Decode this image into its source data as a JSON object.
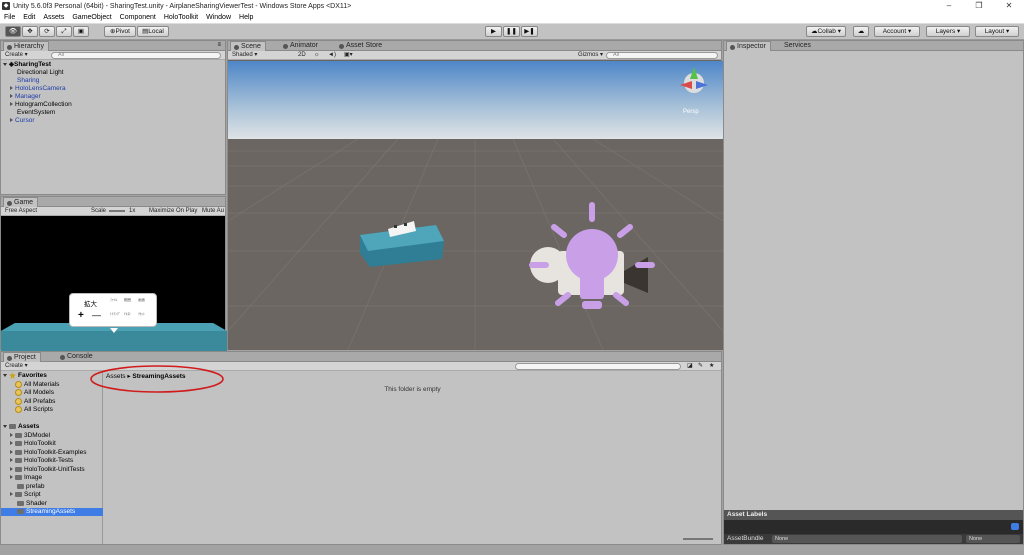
{
  "window": {
    "title": "Unity 5.6.0f3 Personal (64bit) - SharingTest.unity - AirplaneSharingViewerTest - Windows Store Apps <DX11>"
  },
  "menu": [
    "File",
    "Edit",
    "Assets",
    "GameObject",
    "Component",
    "HoloToolkit",
    "Window",
    "Help"
  ],
  "toolbar": {
    "pivot": "Pivot",
    "local": "Local",
    "collab": "Collab",
    "account": "Account",
    "layers": "Layers",
    "layout": "Layout"
  },
  "hierarchy": {
    "tab": "Hierarchy",
    "create": "Create",
    "search_placeholder": "All",
    "scene": "SharingTest",
    "items": [
      "Directional Light",
      "Sharing",
      "HoloLensCamera",
      "Manager",
      "HologramCollection",
      "EventSystem",
      "Cursor"
    ]
  },
  "scene": {
    "tabs": [
      "Scene",
      "Animator",
      "Asset Store"
    ],
    "shading": "Shaded",
    "mode2d": "2D",
    "gizmos": "Gizmos",
    "search_placeholder": "All",
    "persp": "Persp"
  },
  "game": {
    "tab": "Game",
    "aspect": "Free Aspect",
    "scale_label": "Scale",
    "scale_value": "1x",
    "maximize": "Maximize On Play",
    "mute": "Mute Au",
    "popup": {
      "title": "拡大",
      "plus": "+",
      "minus": "—",
      "opts": [
        "ﾌｧｲﾙ",
        "範囲",
        "画面",
        "ﾄﾘﾐﾝｸﾞ",
        "ﾃｷｽﾄ",
        "ﾘｾｯﾄ"
      ]
    }
  },
  "project": {
    "tabs": [
      "Project",
      "Console"
    ],
    "create": "Create",
    "favorites_title": "Favorites",
    "favorites": [
      "All Materials",
      "All Models",
      "All Prefabs",
      "All Scripts"
    ],
    "assets_title": "Assets",
    "assets": [
      "3DModel",
      "HoloToolkit",
      "HoloToolkit-Examples",
      "HoloToolkit-Tests",
      "HoloToolkit-UnitTests",
      "Image",
      "prefab",
      "Script",
      "Shader",
      "StreamingAssets"
    ],
    "breadcrumb": [
      "Assets",
      "StreamingAssets"
    ],
    "empty_text": "This folder is empty"
  },
  "inspector": {
    "tabs": [
      "Inspector",
      "Services"
    ],
    "asset_labels": "Asset Labels",
    "asset_bundle": "AssetBundle",
    "none1": "None",
    "none2": "None"
  },
  "colors": {
    "selection": "#3e7ce6",
    "circle": "#d11a1a",
    "bulb": "#c9a0e8"
  }
}
